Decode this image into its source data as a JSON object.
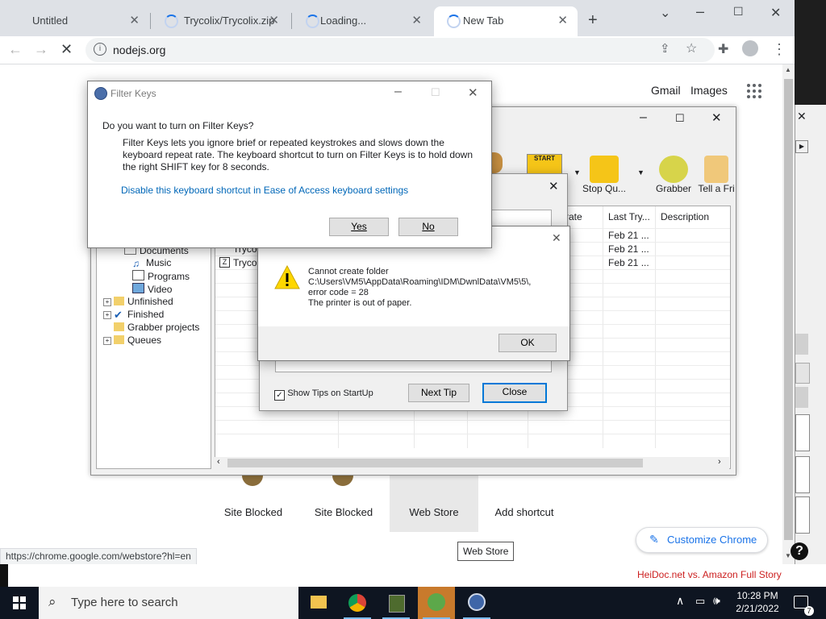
{
  "browser": {
    "tabs": [
      {
        "label": "Untitled",
        "loading": false,
        "active": false
      },
      {
        "label": "Trycolix/Trycolix.zip a",
        "loading": true,
        "active": false
      },
      {
        "label": "Loading...",
        "loading": true,
        "active": false
      },
      {
        "label": "New Tab",
        "loading": true,
        "active": true
      }
    ],
    "new_tab_symbol": "+",
    "address": "nodejs.org",
    "top_links": {
      "gmail": "Gmail",
      "images": "Images"
    },
    "shortcuts": [
      {
        "label": "Site Blocked"
      },
      {
        "label": "Site Blocked"
      },
      {
        "label": "Web Store"
      },
      {
        "label": "Add shortcut"
      }
    ],
    "customize_label": "Customize Chrome",
    "status_url": "https://chrome.google.com/webstore?hl=en",
    "tooltip": "Web Store"
  },
  "idm": {
    "toolbar": [
      {
        "label": "Stop Qu..."
      },
      {
        "label": "Grabber"
      },
      {
        "label": "Tell a Fri"
      }
    ],
    "tree": [
      {
        "label": "Documents",
        "level": 2
      },
      {
        "label": "Music",
        "level": 2
      },
      {
        "label": "Programs",
        "level": 2
      },
      {
        "label": "Video",
        "level": 2
      },
      {
        "label": "Unfinished",
        "level": 1
      },
      {
        "label": "Finished",
        "level": 1
      },
      {
        "label": "Grabber projects",
        "level": 1
      },
      {
        "label": "Queues",
        "level": 1
      }
    ],
    "columns": {
      "rate": "rate",
      "last_try": "Last Try...",
      "description": "Description"
    },
    "rows": [
      {
        "name": "",
        "last_try": "Feb 21 ..."
      },
      {
        "name": "Trycol",
        "last_try": "Feb 21 ..."
      },
      {
        "name": "Trycol",
        "last_try": "Feb 21 ..."
      }
    ]
  },
  "tips_dialog": {
    "show_tips_label": "Show Tips on StartUp",
    "show_tips_checked": true,
    "next_tip": "Next Tip",
    "close": "Close"
  },
  "filter_keys": {
    "title": "Filter Keys",
    "question": "Do you want to turn on Filter Keys?",
    "description": "Filter Keys lets you ignore brief or repeated keystrokes and slows down the keyboard repeat rate.  The keyboard shortcut to turn on Filter Keys is to hold down the right SHIFT key for 8 seconds.",
    "link": "Disable this keyboard shortcut in Ease of Access keyboard settings",
    "yes": "Yes",
    "no": "No"
  },
  "error_dialog": {
    "message": "Cannot create folder\nC:\\Users\\VM5\\AppData\\Roaming\\IDM\\DwnlData\\VM5\\5\\,\nerror code = 28\nThe printer is out of paper.",
    "ok": "OK"
  },
  "taskbar": {
    "search_placeholder": "Type here to search",
    "time": "10:28 PM",
    "date": "2/21/2022",
    "notification_count": "7"
  },
  "footer_link": "HeiDoc.net vs. Amazon Full Story",
  "colors": {
    "accent": "#1a73e8",
    "error_red": "#cc1f1f",
    "taskbar": "#0e1521"
  }
}
